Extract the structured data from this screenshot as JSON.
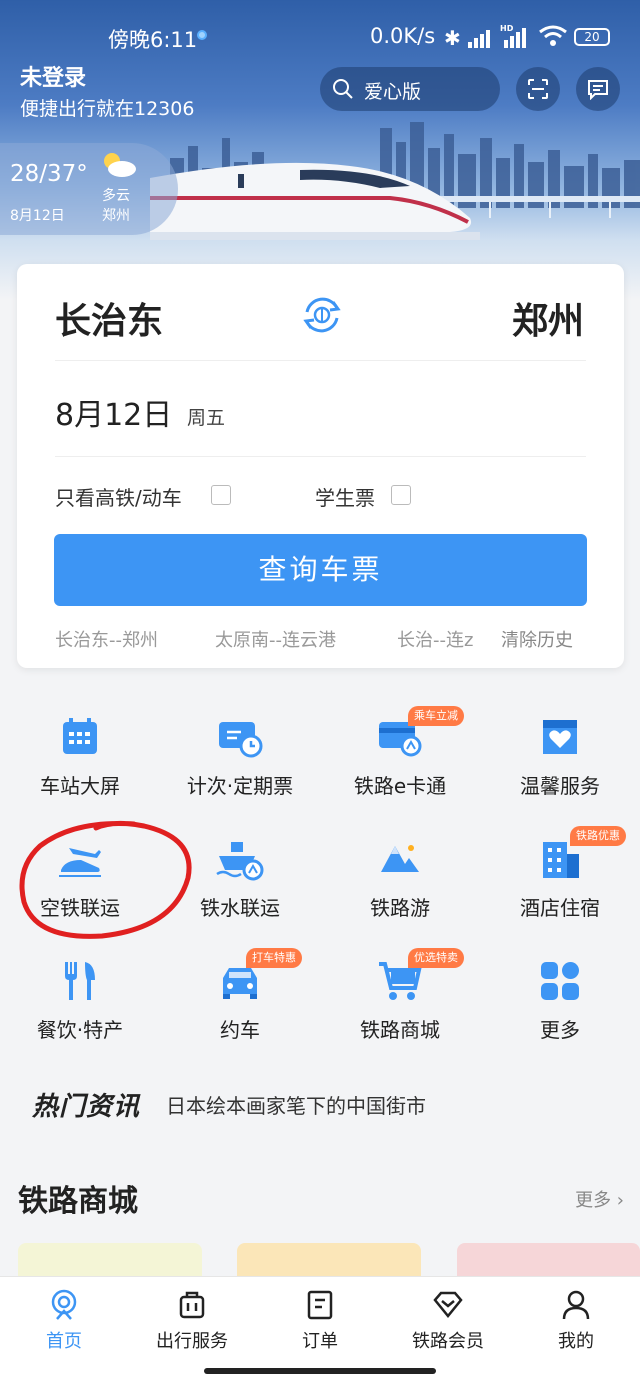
{
  "status_bar": {
    "time": "傍晚6:11",
    "net_speed": "0.0K/s",
    "network_badge": "HD",
    "battery": "20"
  },
  "header": {
    "login_title": "未登录",
    "login_subtitle": "便捷出行就在12306",
    "search_label": "爱心版",
    "icons": [
      "search-icon",
      "scan-icon",
      "message-icon"
    ]
  },
  "weather": {
    "temp": "28/37°",
    "date": "8月12日",
    "condition": "多云",
    "city": "郑州"
  },
  "ticket": {
    "from": "长治东",
    "to": "郑州",
    "date": "8月12日",
    "weekday": "周五",
    "option_high_speed": "只看高铁/动车",
    "option_student": "学生票",
    "query_button": "查询车票",
    "history": [
      "长治东--郑州",
      "太原南--连云港",
      "长治--连z"
    ],
    "clear_history": "清除历史"
  },
  "services": [
    {
      "label": "车站大屏",
      "icon": "station-screen-icon"
    },
    {
      "label": "计次·定期票",
      "icon": "ticket-card-icon"
    },
    {
      "label": "铁路e卡通",
      "icon": "ecard-icon",
      "badge": "乘车立减"
    },
    {
      "label": "温馨服务",
      "icon": "heart-service-icon"
    },
    {
      "label": "空铁联运",
      "icon": "plane-train-icon"
    },
    {
      "label": "铁水联运",
      "icon": "ship-train-icon"
    },
    {
      "label": "铁路游",
      "icon": "mountain-icon"
    },
    {
      "label": "酒店住宿",
      "icon": "hotel-icon",
      "badge": "铁路优惠"
    },
    {
      "label": "餐饮·特产",
      "icon": "dining-icon"
    },
    {
      "label": "约车",
      "icon": "car-icon",
      "badge": "打车特惠"
    },
    {
      "label": "铁路商城",
      "icon": "cart-icon",
      "badge": "优选特卖"
    },
    {
      "label": "更多",
      "icon": "more-grid-icon"
    }
  ],
  "news": {
    "logo": "热门资讯",
    "headline": "日本绘本画家笔下的中国街市"
  },
  "mall": {
    "title": "铁路商城",
    "more": "更多"
  },
  "bottom_nav": [
    {
      "label": "首页",
      "icon": "home-icon",
      "active": true
    },
    {
      "label": "出行服务",
      "icon": "luggage-icon"
    },
    {
      "label": "订单",
      "icon": "order-icon"
    },
    {
      "label": "铁路会员",
      "icon": "member-diamond-icon"
    },
    {
      "label": "我的",
      "icon": "profile-icon"
    }
  ],
  "colors": {
    "accent": "#3d95f4",
    "badge": "#ff7a45",
    "annotation_circle": "#e02020"
  }
}
